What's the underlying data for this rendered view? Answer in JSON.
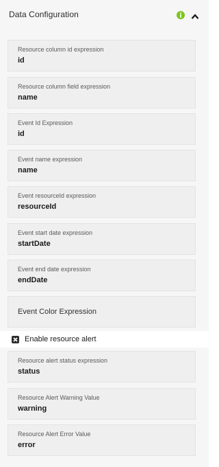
{
  "header": {
    "title": "Data Configuration"
  },
  "fields": [
    {
      "label": "Resource column id expression",
      "value": "id"
    },
    {
      "label": "Resource column field expression",
      "value": "name"
    },
    {
      "label": "Event Id Expression",
      "value": "id"
    },
    {
      "label": "Event name expression",
      "value": "name"
    },
    {
      "label": "Event resourceId expression",
      "value": "resourceId"
    },
    {
      "label": "Event start date expression",
      "value": "startDate"
    },
    {
      "label": "Event end date expression",
      "value": "endDate"
    }
  ],
  "color_field": {
    "placeholder": "Event Color Expression"
  },
  "alert_checkbox": {
    "label": "Enable resource alert",
    "checked": true
  },
  "alert_fields": [
    {
      "label": "Resource alert status expression",
      "value": "status"
    },
    {
      "label": "Resource Alert Warning Value",
      "value": "warning"
    },
    {
      "label": "Resource Alert Error Value",
      "value": "error"
    }
  ],
  "colors": {
    "info_icon": "#7cc51f",
    "checkbox": "#2c2c2c",
    "field_bg": "#efefef"
  }
}
